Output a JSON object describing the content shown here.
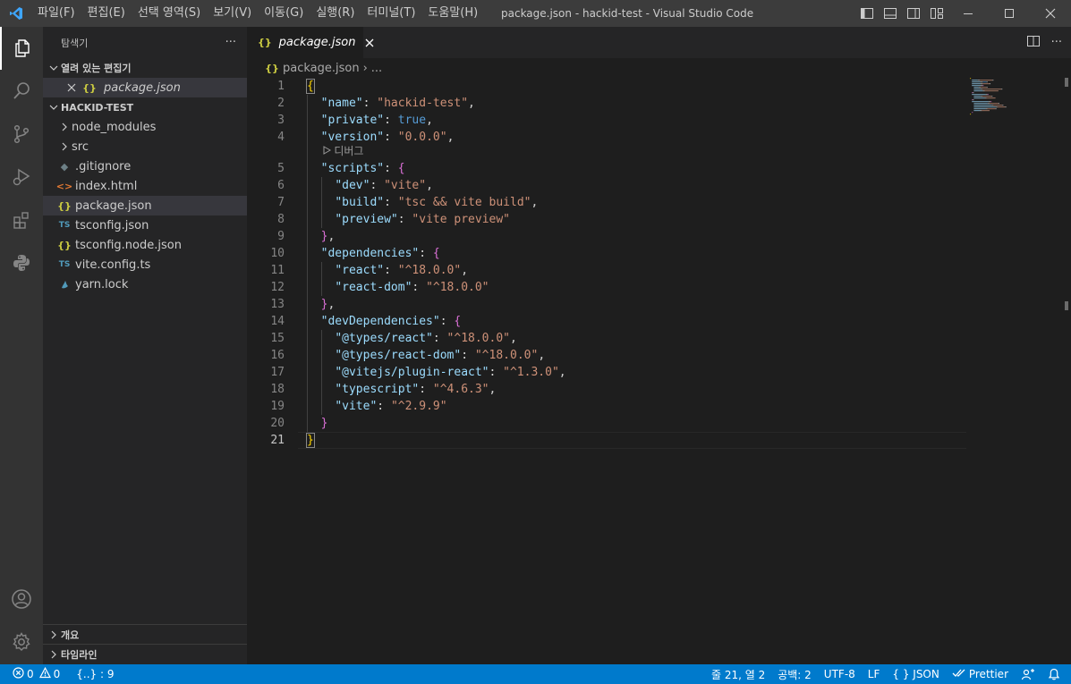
{
  "window": {
    "title": "package.json - hackid-test - Visual Studio Code",
    "menu": [
      "파일(F)",
      "편집(E)",
      "선택 영역(S)",
      "보기(V)",
      "이동(G)",
      "실행(R)",
      "터미널(T)",
      "도움말(H)"
    ]
  },
  "sidebar": {
    "title": "탐색기",
    "more": "···",
    "open_editors": {
      "label": "열려 있는 편집기",
      "items": [
        {
          "icon": "{}",
          "label": "package.json"
        }
      ]
    },
    "workspace": {
      "label": "HACKID-TEST",
      "items": [
        {
          "type": "folder",
          "label": "node_modules"
        },
        {
          "type": "folder",
          "label": "src"
        },
        {
          "type": "file",
          "icon": "◆",
          "label": ".gitignore"
        },
        {
          "type": "file",
          "icon": "<>",
          "label": "index.html"
        },
        {
          "type": "file",
          "icon": "{}",
          "label": "package.json"
        },
        {
          "type": "file",
          "icon": "TS",
          "label": "tsconfig.json"
        },
        {
          "type": "file",
          "icon": "{}",
          "label": "tsconfig.node.json"
        },
        {
          "type": "file",
          "icon": "TS",
          "label": "vite.config.ts"
        },
        {
          "type": "file",
          "icon": "yarn",
          "label": "yarn.lock"
        }
      ]
    },
    "outline_label": "개요",
    "timeline_label": "타임라인"
  },
  "editor": {
    "tab": {
      "icon": "{}",
      "label": "package.json"
    },
    "breadcrumb": {
      "icon": "{}",
      "file": "package.json",
      "sep": "›",
      "more": "..."
    },
    "codelens": "디버그",
    "lines": [
      [
        [
          "{",
          "br1"
        ]
      ],
      [
        [
          "  ",
          "p"
        ],
        [
          "\"name\"",
          "k"
        ],
        [
          ": ",
          "p"
        ],
        [
          "\"hackid-test\"",
          "s"
        ],
        [
          ",",
          "p"
        ]
      ],
      [
        [
          "  ",
          "p"
        ],
        [
          "\"private\"",
          "k"
        ],
        [
          ": ",
          "p"
        ],
        [
          "true",
          "b"
        ],
        [
          ",",
          "p"
        ]
      ],
      [
        [
          "  ",
          "p"
        ],
        [
          "\"version\"",
          "k"
        ],
        [
          ": ",
          "p"
        ],
        [
          "\"0.0.0\"",
          "s"
        ],
        [
          ",",
          "p"
        ]
      ],
      [
        [
          "  ",
          "p"
        ],
        [
          "\"scripts\"",
          "k"
        ],
        [
          ": ",
          "p"
        ],
        [
          "{",
          "br2"
        ]
      ],
      [
        [
          "    ",
          "p"
        ],
        [
          "\"dev\"",
          "k"
        ],
        [
          ": ",
          "p"
        ],
        [
          "\"vite\"",
          "s"
        ],
        [
          ",",
          "p"
        ]
      ],
      [
        [
          "    ",
          "p"
        ],
        [
          "\"build\"",
          "k"
        ],
        [
          ": ",
          "p"
        ],
        [
          "\"tsc && vite build\"",
          "s"
        ],
        [
          ",",
          "p"
        ]
      ],
      [
        [
          "    ",
          "p"
        ],
        [
          "\"preview\"",
          "k"
        ],
        [
          ": ",
          "p"
        ],
        [
          "\"vite preview\"",
          "s"
        ]
      ],
      [
        [
          "  ",
          "p"
        ],
        [
          "}",
          "br2"
        ],
        [
          ",",
          "p"
        ]
      ],
      [
        [
          "  ",
          "p"
        ],
        [
          "\"dependencies\"",
          "k"
        ],
        [
          ": ",
          "p"
        ],
        [
          "{",
          "br2"
        ]
      ],
      [
        [
          "    ",
          "p"
        ],
        [
          "\"react\"",
          "k"
        ],
        [
          ": ",
          "p"
        ],
        [
          "\"^18.0.0\"",
          "s"
        ],
        [
          ",",
          "p"
        ]
      ],
      [
        [
          "    ",
          "p"
        ],
        [
          "\"react-dom\"",
          "k"
        ],
        [
          ": ",
          "p"
        ],
        [
          "\"^18.0.0\"",
          "s"
        ]
      ],
      [
        [
          "  ",
          "p"
        ],
        [
          "}",
          "br2"
        ],
        [
          ",",
          "p"
        ]
      ],
      [
        [
          "  ",
          "p"
        ],
        [
          "\"devDependencies\"",
          "k"
        ],
        [
          ": ",
          "p"
        ],
        [
          "{",
          "br2"
        ]
      ],
      [
        [
          "    ",
          "p"
        ],
        [
          "\"@types/react\"",
          "k"
        ],
        [
          ": ",
          "p"
        ],
        [
          "\"^18.0.0\"",
          "s"
        ],
        [
          ",",
          "p"
        ]
      ],
      [
        [
          "    ",
          "p"
        ],
        [
          "\"@types/react-dom\"",
          "k"
        ],
        [
          ": ",
          "p"
        ],
        [
          "\"^18.0.0\"",
          "s"
        ],
        [
          ",",
          "p"
        ]
      ],
      [
        [
          "    ",
          "p"
        ],
        [
          "\"@vitejs/plugin-react\"",
          "k"
        ],
        [
          ": ",
          "p"
        ],
        [
          "\"^1.3.0\"",
          "s"
        ],
        [
          ",",
          "p"
        ]
      ],
      [
        [
          "    ",
          "p"
        ],
        [
          "\"typescript\"",
          "k"
        ],
        [
          ": ",
          "p"
        ],
        [
          "\"^4.6.3\"",
          "s"
        ],
        [
          ",",
          "p"
        ]
      ],
      [
        [
          "    ",
          "p"
        ],
        [
          "\"vite\"",
          "k"
        ],
        [
          ": ",
          "p"
        ],
        [
          "\"^2.9.9\"",
          "s"
        ]
      ],
      [
        [
          "  ",
          "p"
        ],
        [
          "}",
          "br2"
        ]
      ],
      [
        [
          "}",
          "br1"
        ]
      ]
    ]
  },
  "statusbar": {
    "errors": "0",
    "warnings": "0",
    "json_count": "{..} : 9",
    "position": "줄 21, 열 2",
    "spaces": "공백: 2",
    "encoding": "UTF-8",
    "eol": "LF",
    "language": "{ } JSON",
    "prettier": "Prettier"
  },
  "colors": {
    "accent": "#007acc",
    "activity_bar": "#333333",
    "sidebar": "#252526",
    "editor": "#1e1e1e"
  }
}
